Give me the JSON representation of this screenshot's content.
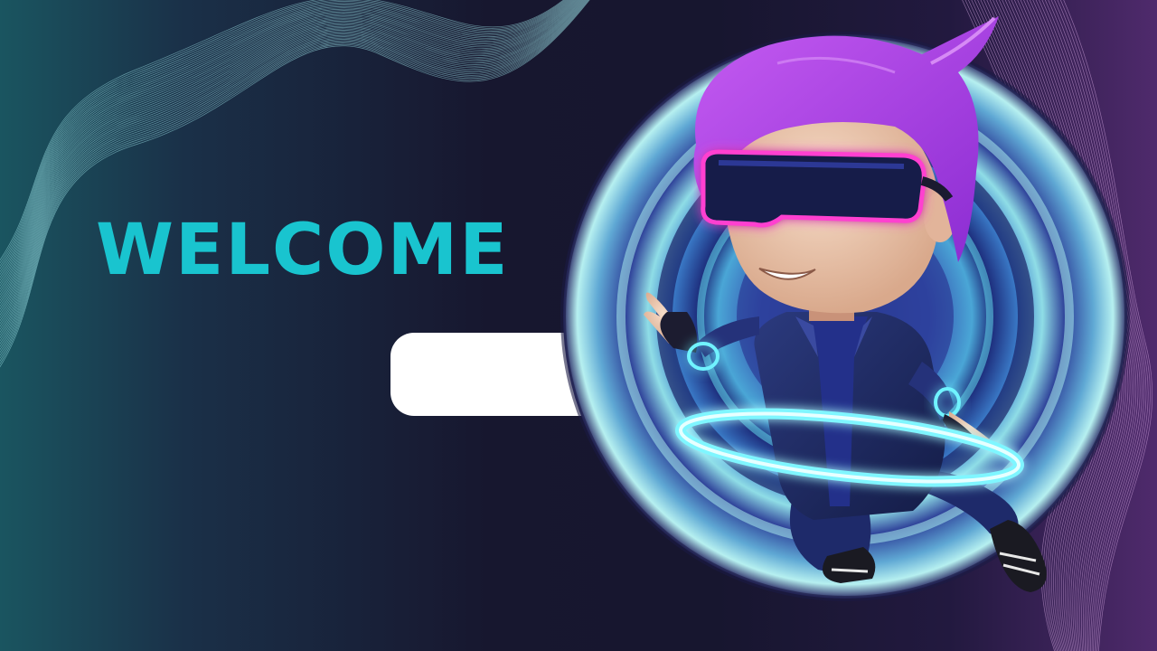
{
  "slide": {
    "heading": "WELCOME",
    "button_label": ""
  },
  "illustration": {
    "subject": "character-vr-headset-icon"
  },
  "colors": {
    "heading": "#19c4cf",
    "background": "#17162f",
    "hair": "#a83ee0",
    "visor_glow": "#ff3fd0",
    "ring_glow": "#7ff6ff"
  }
}
